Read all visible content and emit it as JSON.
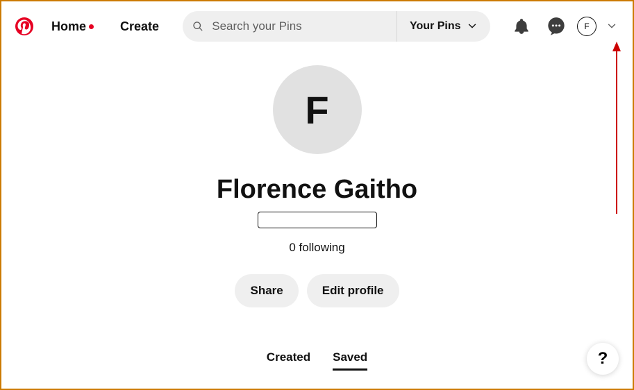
{
  "header": {
    "home_label": "Home",
    "create_label": "Create",
    "search_placeholder": "Search your Pins",
    "filter_label": "Your Pins",
    "avatar_initial": "F"
  },
  "profile": {
    "avatar_initial": "F",
    "full_name": "Florence Gaitho",
    "following": "0 following",
    "share_label": "Share",
    "edit_label": "Edit profile"
  },
  "tabs": {
    "created": "Created",
    "saved": "Saved"
  },
  "help_label": "?"
}
